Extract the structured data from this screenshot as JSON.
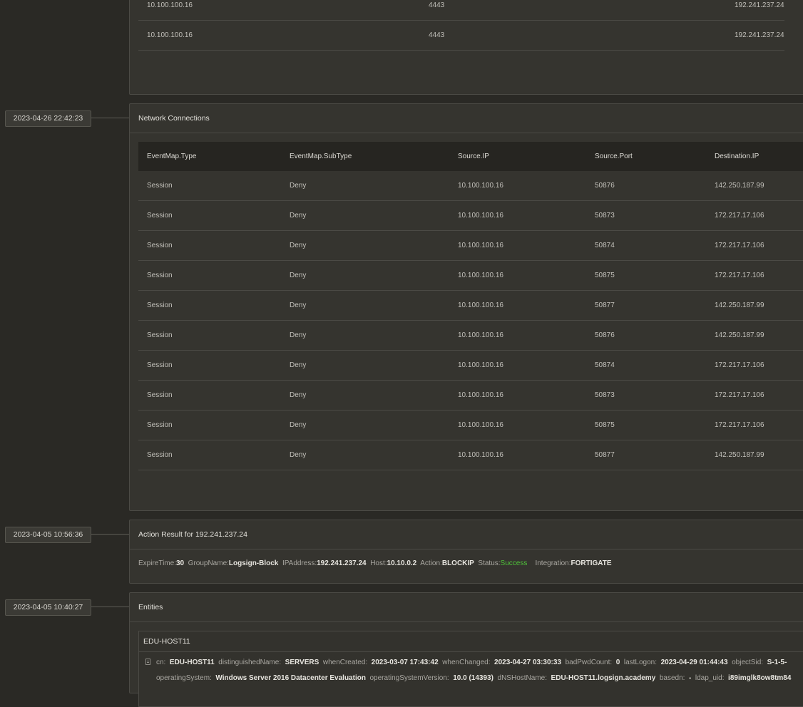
{
  "top_table": {
    "rows": [
      {
        "source_ip": "10.100.100.16",
        "port": "4443",
        "dest_ip": "192.241.237.24"
      },
      {
        "source_ip": "10.100.100.16",
        "port": "4443",
        "dest_ip": "192.241.237.24"
      }
    ]
  },
  "network": {
    "date": "2023-04-26 22:42:23",
    "title": "Network Connections",
    "columns": [
      "EventMap.Type",
      "EventMap.SubType",
      "Source.IP",
      "Source.Port",
      "Destination.IP"
    ],
    "rows": [
      [
        "Session",
        "Deny",
        "10.100.100.16",
        "50876",
        "142.250.187.99"
      ],
      [
        "Session",
        "Deny",
        "10.100.100.16",
        "50873",
        "172.217.17.106"
      ],
      [
        "Session",
        "Deny",
        "10.100.100.16",
        "50874",
        "172.217.17.106"
      ],
      [
        "Session",
        "Deny",
        "10.100.100.16",
        "50875",
        "172.217.17.106"
      ],
      [
        "Session",
        "Deny",
        "10.100.100.16",
        "50877",
        "142.250.187.99"
      ],
      [
        "Session",
        "Deny",
        "10.100.100.16",
        "50876",
        "142.250.187.99"
      ],
      [
        "Session",
        "Deny",
        "10.100.100.16",
        "50874",
        "172.217.17.106"
      ],
      [
        "Session",
        "Deny",
        "10.100.100.16",
        "50873",
        "172.217.17.106"
      ],
      [
        "Session",
        "Deny",
        "10.100.100.16",
        "50875",
        "172.217.17.106"
      ],
      [
        "Session",
        "Deny",
        "10.100.100.16",
        "50877",
        "142.250.187.99"
      ]
    ]
  },
  "action": {
    "date": "2023-04-05 10:56:36",
    "title": "Action Result for 192.241.237.24",
    "expire_key": "ExpireTime:",
    "expire_val": "30",
    "group_key": "GroupName:",
    "group_val": "Logsign-Block",
    "ip_key": "IPAddress:",
    "ip_val": "192.241.237.24",
    "host_key": "Host:",
    "host_val": "10.10.0.2",
    "action_key": "Action:",
    "action_val": "BLOCKIP",
    "status_key": "Status:",
    "status_val": "Success",
    "integration_key": "Integration:",
    "integration_val": "FORTIGATE",
    "status_color": "#4fc23a"
  },
  "entities": {
    "date": "2023-04-05 10:40:27",
    "title": "Entities",
    "entity_name": "EDU-HOST11",
    "line1": [
      {
        "k": "cn:",
        "v": "EDU-HOST11"
      },
      {
        "k": "distinguishedName:",
        "v": "SERVERS"
      },
      {
        "k": "whenCreated:",
        "v": "2023-03-07 17:43:42"
      },
      {
        "k": "whenChanged:",
        "v": "2023-04-27 03:30:33"
      },
      {
        "k": "badPwdCount:",
        "v": "0"
      },
      {
        "k": "lastLogon:",
        "v": "2023-04-29 01:44:43"
      },
      {
        "k": "objectSid:",
        "v": "S-1-5-"
      }
    ],
    "line2": [
      {
        "k": "operatingSystem:",
        "v": "Windows Server 2016 Datacenter Evaluation"
      },
      {
        "k": "operatingSystemVersion:",
        "v": "10.0 (14393)"
      },
      {
        "k": "dNSHostName:",
        "v": "EDU-HOST11.logsign.academy"
      },
      {
        "k": "basedn:",
        "v": "-"
      },
      {
        "k": "ldap_uid:",
        "v": "i89imglk8ow8tm84"
      }
    ]
  }
}
